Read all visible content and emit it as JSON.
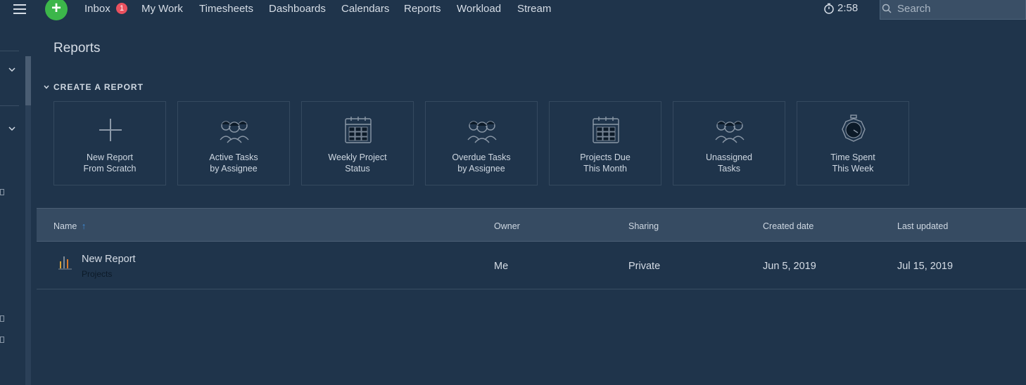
{
  "nav": {
    "add_label": "+",
    "items": [
      {
        "label": "Inbox"
      },
      {
        "label": "My Work"
      },
      {
        "label": "Timesheets"
      },
      {
        "label": "Dashboards"
      },
      {
        "label": "Calendars"
      },
      {
        "label": "Reports"
      },
      {
        "label": "Workload"
      },
      {
        "label": "Stream"
      }
    ],
    "inbox_badge": "1",
    "timer": "2:58",
    "search_placeholder": "Search"
  },
  "page": {
    "title": "Reports",
    "section_title": "CREATE A REPORT"
  },
  "cards": [
    {
      "label": "New Report\nFrom Scratch",
      "icon": "plus-icon"
    },
    {
      "label": "Active Tasks\nby Assignee",
      "icon": "people-icon"
    },
    {
      "label": "Weekly Project\nStatus",
      "icon": "calendar-icon"
    },
    {
      "label": "Overdue Tasks\nby Assignee",
      "icon": "people-icon"
    },
    {
      "label": "Projects Due\nThis Month",
      "icon": "calendar-icon"
    },
    {
      "label": "Unassigned\nTasks",
      "icon": "people-icon"
    },
    {
      "label": "Time Spent\nThis Week",
      "icon": "stopwatch-icon"
    }
  ],
  "table": {
    "columns": [
      "Name",
      "Owner",
      "Sharing",
      "Created date",
      "Last updated"
    ],
    "sort_indicator": "↑",
    "rows": [
      {
        "name": "New Report",
        "subtitle": "Projects",
        "owner": "Me",
        "sharing": "Private",
        "created": "Jun 5, 2019",
        "updated": "Jul 15, 2019"
      }
    ]
  },
  "colors": {
    "background": "#1f344b",
    "accent_green": "#3cb64a",
    "badge_red": "#e9515f",
    "sort_blue": "#3d8fe0"
  }
}
